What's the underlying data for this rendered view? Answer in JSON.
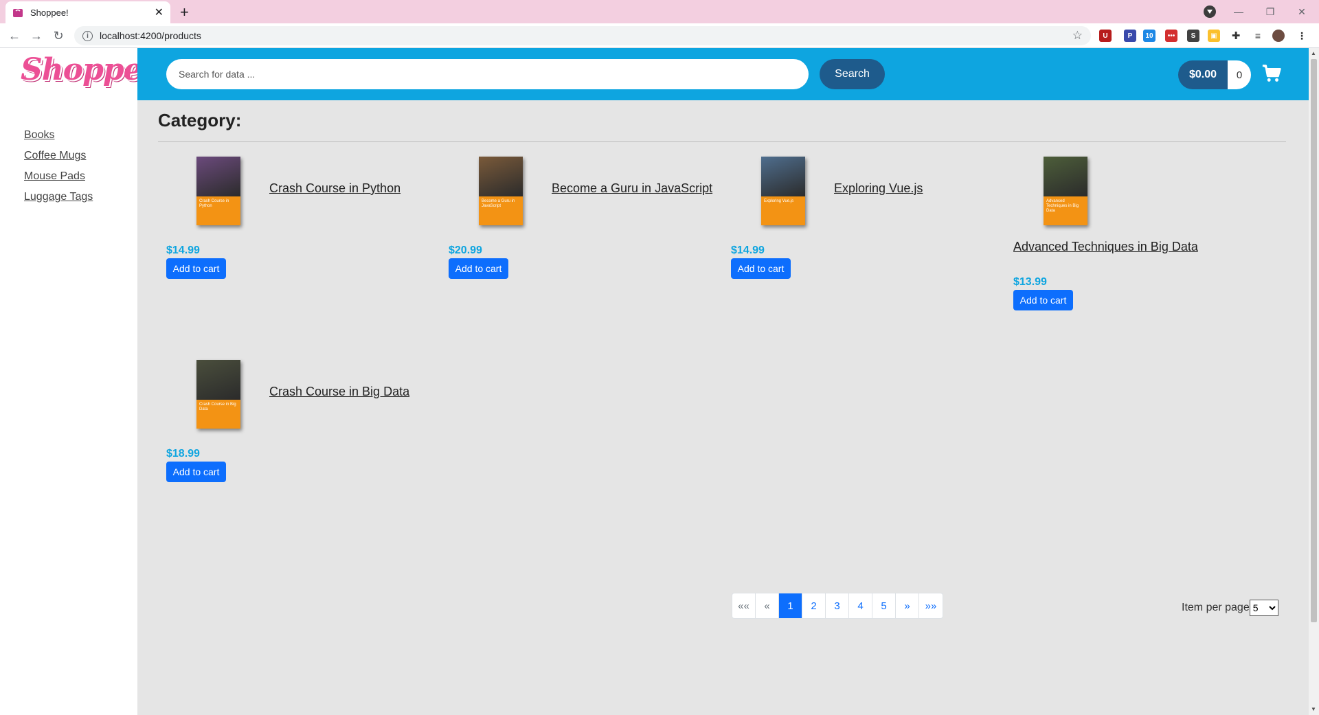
{
  "browser": {
    "tab_title": "Shoppee!",
    "url": "localhost:4200/products"
  },
  "app": {
    "logo_text": "Shoppee",
    "search": {
      "placeholder": "Search for data ...",
      "button_label": "Search"
    },
    "cart": {
      "total": "$0.00",
      "count": "0"
    },
    "categories": [
      "Books",
      "Coffee Mugs",
      "Mouse Pads",
      "Luggage Tags"
    ],
    "page_title": "Category:",
    "products": [
      {
        "name": "Crash Course in Python",
        "price": "$14.99",
        "button": "Add to cart",
        "cover_text": "Crash Course in Python",
        "cover_photo_color": "#6b4a7c"
      },
      {
        "name": "Become a Guru in JavaScript",
        "price": "$20.99",
        "button": "Add to cart",
        "cover_text": "Become a Guru in JavaScript",
        "cover_photo_color": "#7a5a3a"
      },
      {
        "name": "Exploring Vue.js",
        "price": "$14.99",
        "button": "Add to cart",
        "cover_text": "Exploring Vue.js",
        "cover_photo_color": "#4f6e8e"
      },
      {
        "name": "Advanced Techniques in Big Data",
        "price": "$13.99",
        "button": "Add to cart",
        "cover_text": "Advanced Techniques in Big Data",
        "cover_photo_color": "#4d5e3a"
      },
      {
        "name": "Crash Course in Big Data",
        "price": "$18.99",
        "button": "Add to cart",
        "cover_text": "Crash Course in Big Data",
        "cover_photo_color": "#4a4e3c"
      }
    ],
    "pagination": {
      "first": "««",
      "prev": "«",
      "pages": [
        "1",
        "2",
        "3",
        "4",
        "5"
      ],
      "active_page": "1",
      "next": "»",
      "last": "»»"
    },
    "items_per_page": {
      "label": "Item per page",
      "value": "5"
    }
  },
  "colors": {
    "header": "#0ea5e0",
    "accent_dark": "#1e5b8c",
    "button": "#0d6efd",
    "price": "#0ea5e0",
    "logo": "#ec4f95",
    "tabbar": "#f3cfe0"
  }
}
